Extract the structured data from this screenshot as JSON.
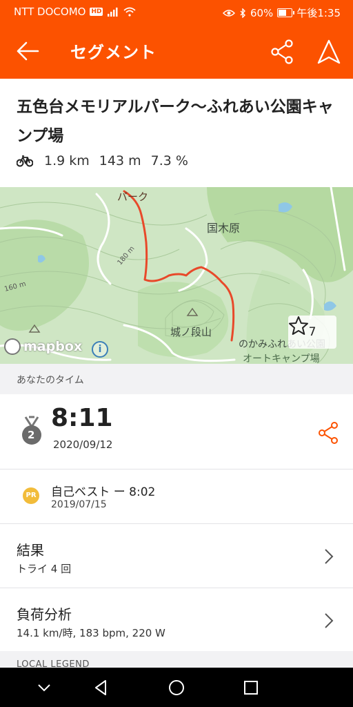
{
  "status_bar": {
    "carrier": "NTT DOCOMO",
    "hd": "HD",
    "battery": "60%",
    "time": "午後1:35"
  },
  "app_bar": {
    "title": "セグメント",
    "icons": [
      "back-arrow-icon",
      "share-icon",
      "navigate-icon"
    ]
  },
  "segment": {
    "title": "五色台メモリアルパーク〜ふれあい公園キャンプ場",
    "distance": "1.9 km",
    "elevation": "143 m",
    "grade": "7.3 %"
  },
  "map": {
    "labels": {
      "park": "パーク",
      "kunikibara": "国木原",
      "joshi": "城ノ段山",
      "camp_line1": "のかみふれあい公園",
      "camp_line2": "オートキャンプ場",
      "contour_180": "180 m",
      "contour_160": "160 m",
      "mapbox": "mapbox",
      "info": "i"
    },
    "star_count": "7",
    "colors": {
      "route": "#e8492a",
      "land": "#cfe6c4"
    }
  },
  "your_time": {
    "header": "あなたのタイム",
    "rank": "2",
    "time": "8:11",
    "date": "2020/09/12"
  },
  "pr": {
    "badge": "PR",
    "label": "自己ベスト ー 8:02",
    "date": "2019/07/15"
  },
  "results": {
    "title": "結果",
    "sub": "トライ 4 回"
  },
  "analysis": {
    "title": "負荷分析",
    "sub": "14.1 km/時, 183 bpm, 220 W"
  },
  "local_legend": {
    "header": "LOCAL LEGEND"
  },
  "colors": {
    "accent": "#fc5200"
  }
}
